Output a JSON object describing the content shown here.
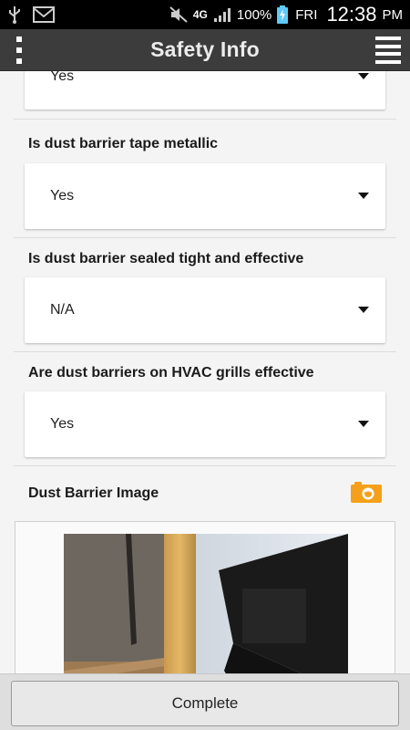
{
  "status_bar": {
    "network": "4G",
    "battery": "100%",
    "day": "FRI",
    "time": "12:38",
    "period": "PM",
    "icons": [
      "usb-icon",
      "gmail-icon",
      "mute-icon",
      "network-4g-icon",
      "signal-icon",
      "battery-charging-icon"
    ]
  },
  "appbar": {
    "title": "Safety Info",
    "left_icon": "overflow-menu-icon",
    "right_icon": "hamburger-menu-icon"
  },
  "form": {
    "questions": [
      {
        "label": "",
        "value": "Yes"
      },
      {
        "label": "Is dust barrier tape metallic",
        "value": "Yes"
      },
      {
        "label": "Is dust barrier sealed tight and effective",
        "value": "N/A"
      },
      {
        "label": "Are dust barriers on HVAC grills effective",
        "value": "Yes"
      }
    ],
    "image_section": {
      "label": "Dust Barrier Image",
      "camera_icon": "camera-icon",
      "camera_color": "#f5a01a"
    }
  },
  "bottom": {
    "complete_label": "Complete"
  }
}
